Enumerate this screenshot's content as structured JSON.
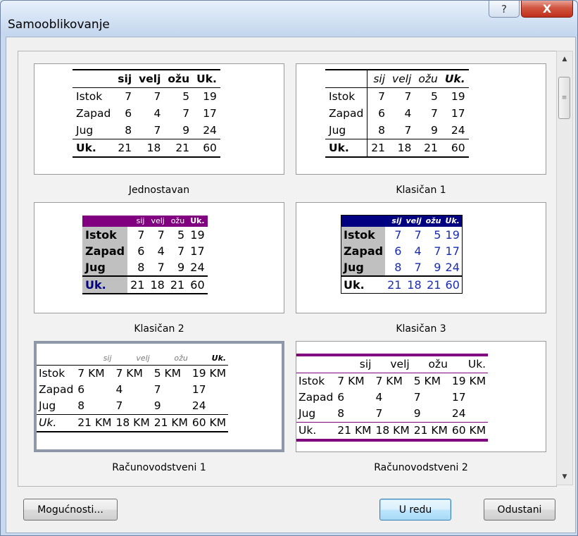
{
  "window": {
    "title": "Samooblikovanje",
    "help_icon": "?",
    "close_icon": "X"
  },
  "formats": [
    {
      "name": "Jednostavan"
    },
    {
      "name": "Klasičan 1"
    },
    {
      "name": "Klasičan 2"
    },
    {
      "name": "Klasičan 3"
    },
    {
      "name": "Računovodstveni 1"
    },
    {
      "name": "Računovodstveni 2"
    }
  ],
  "table": {
    "headers": [
      "sij",
      "velj",
      "ožu",
      "Uk."
    ],
    "rows": [
      {
        "label": "Istok",
        "values": [
          "7",
          "7",
          "5",
          "19"
        ]
      },
      {
        "label": "Zapad",
        "values": [
          "6",
          "4",
          "7",
          "17"
        ]
      },
      {
        "label": "Jug",
        "values": [
          "8",
          "7",
          "9",
          "24"
        ]
      },
      {
        "label": "Uk.",
        "values": [
          "21",
          "18",
          "21",
          "60"
        ]
      }
    ],
    "currency_rows": [
      {
        "label": "Istok",
        "values": [
          "7 KM",
          "7 KM",
          "5 KM",
          "19 KM"
        ]
      },
      {
        "label": "Zapad",
        "values": [
          "6",
          "4",
          "7",
          "17"
        ]
      },
      {
        "label": "Jug",
        "values": [
          "8",
          "7",
          "9",
          "24"
        ]
      },
      {
        "label": "Uk.",
        "values": [
          "21 KM",
          "18 KM",
          "21 KM",
          "60 KM"
        ]
      }
    ]
  },
  "buttons": {
    "options": "Mogućnosti...",
    "ok": "U redu",
    "cancel": "Odustani"
  },
  "colors": {
    "purple": "#800080",
    "navy": "#000080",
    "gray": "#c0c0c0"
  }
}
